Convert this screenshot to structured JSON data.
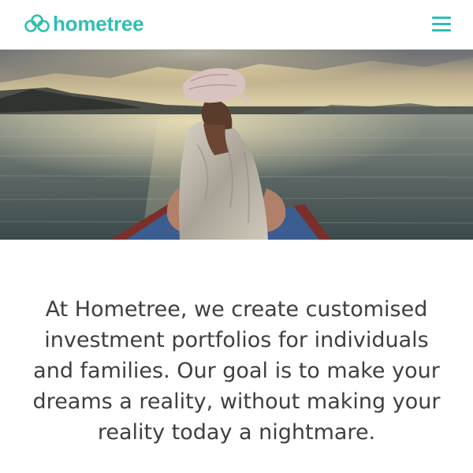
{
  "header": {
    "logo_text": "hometree",
    "logo_icon": "trefoil-logo-icon",
    "menu_icon": "hamburger-menu-icon"
  },
  "colors": {
    "brand": "#2ebfb2",
    "text": "#3f3f3f",
    "background": "#ffffff"
  },
  "hero": {
    "image": "photo: woman in headscarf sitting at the bow of a boat looking at the sea and hills under a sunset sky"
  },
  "intro": {
    "text": "At Hometree, we create customised investment portfolios for individuals and families. Our goal is to make your dreams a reality, without making your reality today a nightmare."
  }
}
